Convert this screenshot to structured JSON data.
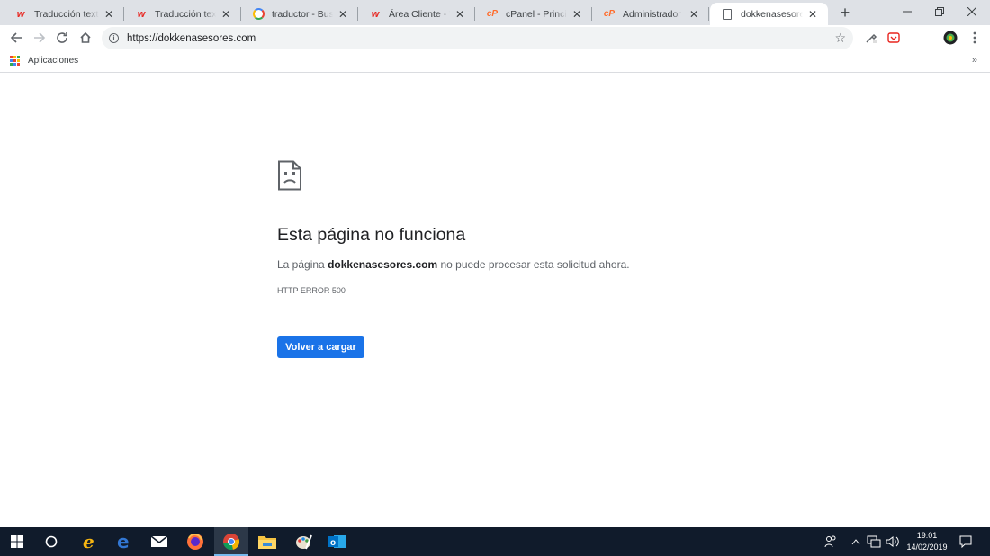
{
  "browser": {
    "tabs": [
      {
        "title": "Traducción texto fi",
        "favicon": "w-icon"
      },
      {
        "title": "Traducción texto fi",
        "favicon": "w-icon"
      },
      {
        "title": "traductor - Buscar",
        "favicon": "google-icon"
      },
      {
        "title": "Área Cliente - Web",
        "favicon": "w-icon"
      },
      {
        "title": "cPanel - Principal",
        "favicon": "cpanel-icon"
      },
      {
        "title": "Administrador de a",
        "favicon": "cpanel-icon"
      },
      {
        "title": "dokkenasesores.com",
        "favicon": "document-icon"
      }
    ],
    "active_tab_index": 6,
    "address_bar": {
      "url": "https://dokkenasesores.com"
    },
    "bookmarks": {
      "apps_label": "Aplicaciones",
      "more": "»"
    }
  },
  "page": {
    "title": "Esta página no funciona",
    "description_prefix": "La página ",
    "domain": "dokkenasesores.com",
    "description_suffix": " no puede procesar esta solicitud ahora.",
    "error_code": "HTTP ERROR 500",
    "reload_label": "Volver a cargar",
    "accent_color": "#1a73e8"
  },
  "taskbar": {
    "time": "19:01",
    "date": "14/02/2019"
  }
}
